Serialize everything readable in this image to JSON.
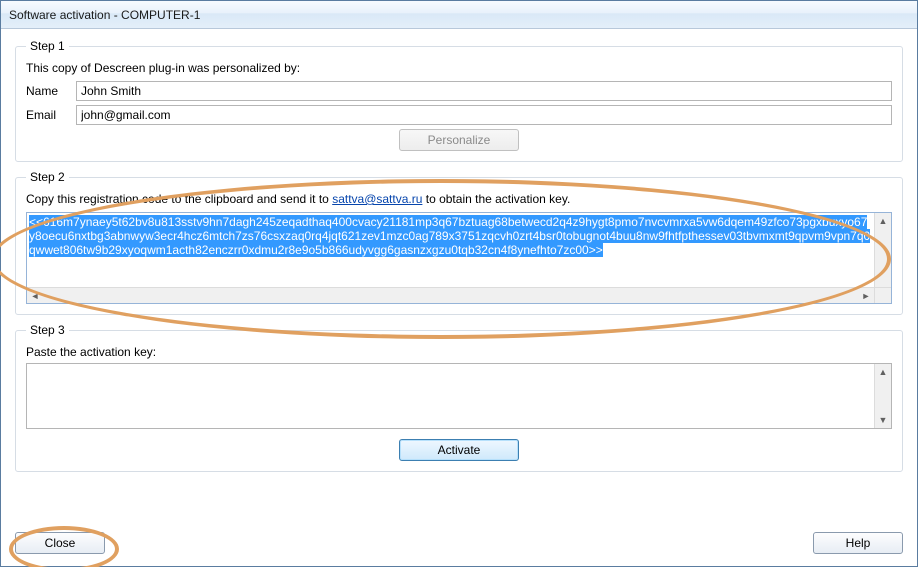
{
  "window": {
    "title": "Software activation - COMPUTER-1"
  },
  "step1": {
    "legend": "Step 1",
    "desc": "This copy of Descreen plug-in was personalized by:",
    "name_label": "Name",
    "name_value": "John Smith",
    "email_label": "Email",
    "email_value": "john@gmail.com",
    "personalize_label": "Personalize"
  },
  "step2": {
    "legend": "Step 2",
    "desc_pre": "Copy this registration code to the clipboard and send it to ",
    "email_link": "sattva@sattva.ru",
    "desc_post": " to obtain the activation key.",
    "code": "<<616m7ynaey5t62bv8u813sstv9hn7dagh245zeqadthaq400cvacy21181mp3q67bztuag68betwecd2q4z9hygt8pmo7nvcvmrxa5vw6dqem49zfco73pgxbuxyo67y8oecu6nxtbg3abnwyw3ecr4hcz6mtch7zs76csxzaq0rq4jqt621zev1mzc0ag789x3751zqcvh0zrt4bsr0tobugnot4buu8nw9fhtfpthessev03tbvmxmt9qpvm9vpn7q0qwwet806tw9b29xyoqwm1acth82enczrr0xdmu2r8e9o5b866udyvgg6gasnzxgzu0tqb32cn4f8ynefhto7zc00>>"
  },
  "step3": {
    "legend": "Step 3",
    "desc": "Paste the activation key:",
    "activate_label": "Activate"
  },
  "buttons": {
    "close": "Close",
    "help": "Help"
  }
}
